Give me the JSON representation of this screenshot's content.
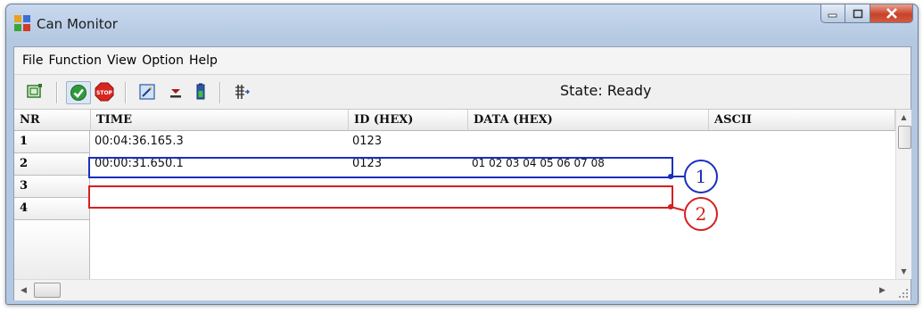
{
  "window": {
    "title": "Can Monitor"
  },
  "menu": [
    "File",
    "Function",
    "View",
    "Option",
    "Help"
  ],
  "toolbar": {
    "buttons": [
      "window-icon",
      "connect-check-icon",
      "stop-icon",
      "edit-icon",
      "download-icon",
      "battery-icon",
      "filter-icon"
    ],
    "stop_label": "STOP",
    "state": "State: Ready"
  },
  "grid": {
    "columns": [
      "NR",
      "TIME",
      "ID (HEX)",
      "DATA (HEX)",
      "ASCII"
    ],
    "rows": [
      {
        "nr": "1",
        "time": "00:04:36.165.3",
        "id": "0123",
        "data": "",
        "ascii": ""
      },
      {
        "nr": "2",
        "time": "00:00:31.650.1",
        "id": "0123",
        "data": "01 02 03 04 05 06 07 08",
        "ascii": ""
      },
      {
        "nr": "3",
        "time": "",
        "id": "",
        "data": "",
        "ascii": ""
      },
      {
        "nr": "4",
        "time": "",
        "id": "",
        "data": "",
        "ascii": ""
      }
    ]
  },
  "annotations": [
    {
      "label": "1",
      "color": "#1a2fbf"
    },
    {
      "label": "2",
      "color": "#d42020"
    }
  ],
  "colors": {
    "titlebar": "#b4c8e2",
    "close": "#c8422a",
    "header_bg": "#eaeaea"
  }
}
